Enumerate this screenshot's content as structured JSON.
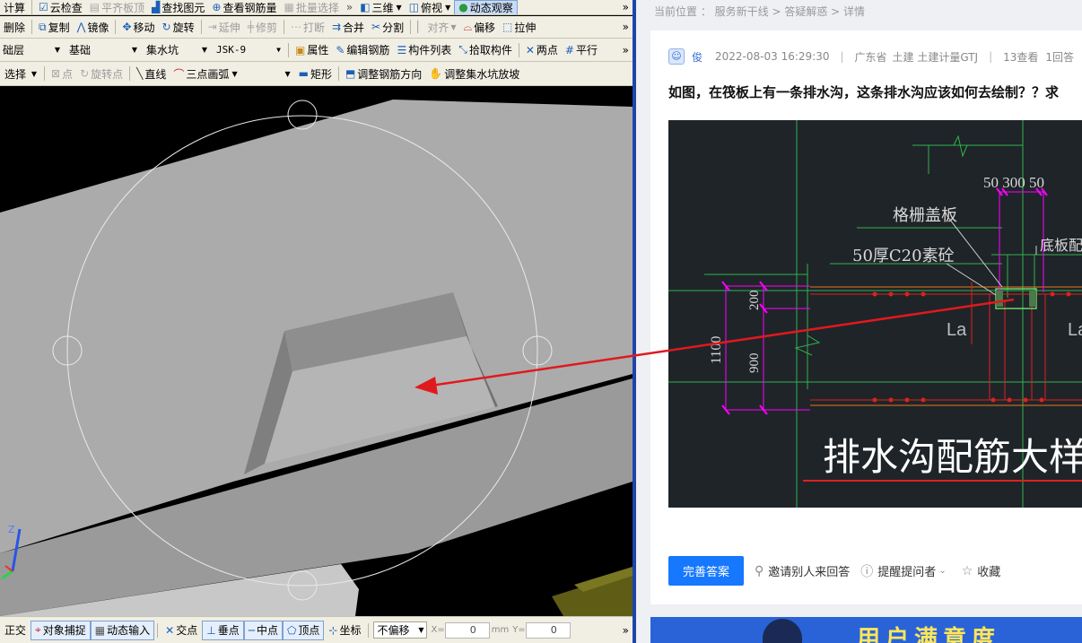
{
  "cad": {
    "toolbar1": {
      "items": [
        "计算",
        "云检查",
        "平齐板顶",
        "查找图元",
        "查看钢筋量",
        "批量选择",
        "三维",
        "俯视",
        "动态观察"
      ],
      "more": "»"
    },
    "toolbar2": {
      "items": [
        "删除",
        "复制",
        "镜像",
        "移动",
        "旋转",
        "延伸",
        "修剪",
        "打断",
        "合并",
        "分割",
        "对齐",
        "偏移",
        "拉伸"
      ],
      "more": "»"
    },
    "toolbar3": {
      "layer": "础层",
      "category": "基础",
      "type": "集水坑",
      "component": "JSK-9",
      "items": [
        "属性",
        "编辑钢筋",
        "构件列表",
        "拾取构件",
        "两点",
        "平行"
      ],
      "more": "»"
    },
    "toolbar4": {
      "select": "选择",
      "items": [
        "点",
        "旋转点",
        "直线",
        "三点画弧",
        "矩形",
        "调整钢筋方向",
        "调整集水坑放坡"
      ]
    },
    "statusbar": {
      "items": [
        "正交",
        "对象捕捉",
        "动态输入",
        "交点",
        "垂点",
        "中点",
        "顶点",
        "坐标"
      ],
      "offset": "不偏移",
      "x_label": "X=",
      "x_value": "0",
      "unit": "mm",
      "y_label": "Y=",
      "y_value": "0",
      "more": "»"
    },
    "axis": {
      "z": "Z"
    }
  },
  "web": {
    "breadcrumb": "当前位置 ： 服务新干线 > 答疑解惑 > 详情",
    "post": {
      "user": "俊",
      "datetime": "2022-08-03 16:29:30",
      "separator": "|",
      "region": "广东省",
      "tags": "土建 土建计量GTJ",
      "views": "13查看",
      "answers": "1回答",
      "question": "如图，在筏板上有一条排水沟，这条排水沟应该如何去绘制？？求"
    },
    "drawing": {
      "dims_top": "50 300 50",
      "label_grate": "格栅盖板",
      "label_concrete": "50厚C20素砼",
      "label_bottom": "底板配",
      "dim_200": "200",
      "dim_900": "900",
      "dim_1100": "1100",
      "la1": "La",
      "la2": "La",
      "title": "排水沟配筋大样"
    },
    "actions": {
      "primary": "完善答案",
      "invite": "邀请别人来回答",
      "remind": "提醒提问者",
      "favorite": "收藏"
    },
    "banner": "用户满意度"
  },
  "colors": {
    "toolbar_bg": "#f1efe4",
    "divider": "#1e46a8",
    "primary": "#1677ff",
    "arrow": "#e0191e",
    "cad_green": "#2fb34a",
    "cad_magenta": "#ff00ff"
  }
}
